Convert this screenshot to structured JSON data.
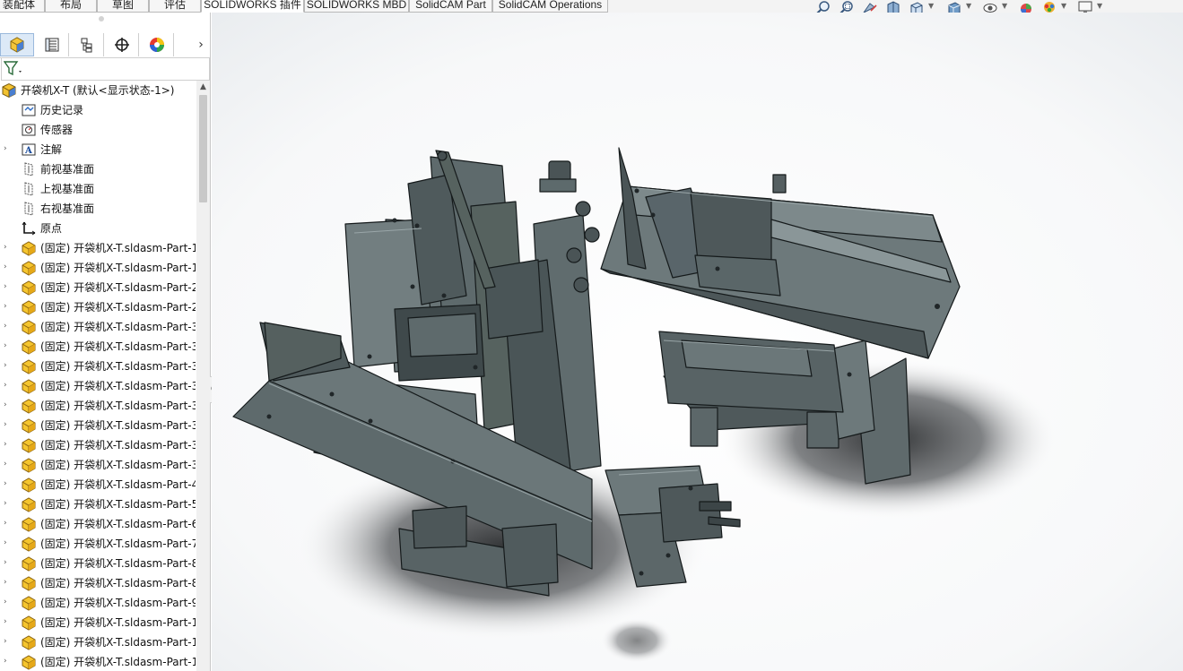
{
  "command_tabs": [
    {
      "label": "装配体"
    },
    {
      "label": "布局"
    },
    {
      "label": "草图"
    },
    {
      "label": "评估"
    },
    {
      "label": "SOLIDWORKS 插件"
    },
    {
      "label": "SOLIDWORKS MBD"
    },
    {
      "label": "SolidCAM Part"
    },
    {
      "label": "SolidCAM Operations"
    }
  ],
  "active_tab": "SOLIDWORKS 插件",
  "view_toolbar_icons": [
    "zoom-to-fit-icon",
    "zoom-to-area-icon",
    "previous-view-icon",
    "section-view-icon",
    "view-orientation-icon",
    "display-style-icon",
    "hide-show-items-icon",
    "edit-appearance-icon",
    "apply-scene-icon",
    "view-settings-icon"
  ],
  "panel_tabs": [
    {
      "name": "feature-manager-tab-icon",
      "active": true
    },
    {
      "name": "property-manager-tab-icon",
      "active": false
    },
    {
      "name": "configuration-manager-tab-icon",
      "active": false
    },
    {
      "name": "dimxpert-manager-tab-icon",
      "active": false
    },
    {
      "name": "display-manager-tab-icon",
      "active": false
    }
  ],
  "tree": {
    "root": {
      "label": "开袋机X-T  (默认<显示状态-1>)"
    },
    "items": [
      {
        "label": "历史记录",
        "icon": "history-icon",
        "expandable": false
      },
      {
        "label": "传感器",
        "icon": "sensor-icon",
        "expandable": false
      },
      {
        "label": "注解",
        "icon": "annotation-icon",
        "expandable": true
      },
      {
        "label": "前视基准面",
        "icon": "plane-icon",
        "expandable": false
      },
      {
        "label": "上视基准面",
        "icon": "plane-icon",
        "expandable": false
      },
      {
        "label": "右视基准面",
        "icon": "plane-icon",
        "expandable": false
      },
      {
        "label": "原点",
        "icon": "origin-icon",
        "expandable": false
      },
      {
        "label": "(固定) 开袋机X-T.sldasm-Part-1",
        "icon": "part-icon",
        "expandable": true
      },
      {
        "label": "(固定) 开袋机X-T.sldasm-Part-1",
        "icon": "part-icon",
        "expandable": true
      },
      {
        "label": "(固定) 开袋机X-T.sldasm-Part-2",
        "icon": "part-icon",
        "expandable": true
      },
      {
        "label": "(固定) 开袋机X-T.sldasm-Part-2",
        "icon": "part-icon",
        "expandable": true
      },
      {
        "label": "(固定) 开袋机X-T.sldasm-Part-3",
        "icon": "part-icon",
        "expandable": true
      },
      {
        "label": "(固定) 开袋机X-T.sldasm-Part-3",
        "icon": "part-icon",
        "expandable": true
      },
      {
        "label": "(固定) 开袋机X-T.sldasm-Part-3",
        "icon": "part-icon",
        "expandable": true
      },
      {
        "label": "(固定) 开袋机X-T.sldasm-Part-3",
        "icon": "part-icon",
        "expandable": true
      },
      {
        "label": "(固定) 开袋机X-T.sldasm-Part-3",
        "icon": "part-icon",
        "expandable": true
      },
      {
        "label": "(固定) 开袋机X-T.sldasm-Part-3",
        "icon": "part-icon",
        "expandable": true
      },
      {
        "label": "(固定) 开袋机X-T.sldasm-Part-3",
        "icon": "part-icon",
        "expandable": true
      },
      {
        "label": "(固定) 开袋机X-T.sldasm-Part-3",
        "icon": "part-icon",
        "expandable": true
      },
      {
        "label": "(固定) 开袋机X-T.sldasm-Part-4",
        "icon": "part-icon",
        "expandable": true
      },
      {
        "label": "(固定) 开袋机X-T.sldasm-Part-5",
        "icon": "part-icon",
        "expandable": true
      },
      {
        "label": "(固定) 开袋机X-T.sldasm-Part-6",
        "icon": "part-icon",
        "expandable": true
      },
      {
        "label": "(固定) 开袋机X-T.sldasm-Part-7",
        "icon": "part-icon",
        "expandable": true
      },
      {
        "label": "(固定) 开袋机X-T.sldasm-Part-8",
        "icon": "part-icon",
        "expandable": true
      },
      {
        "label": "(固定) 开袋机X-T.sldasm-Part-8",
        "icon": "part-icon",
        "expandable": true
      },
      {
        "label": "(固定) 开袋机X-T.sldasm-Part-9",
        "icon": "part-icon",
        "expandable": true
      },
      {
        "label": "(固定) 开袋机X-T.sldasm-Part-1",
        "icon": "part-icon",
        "expandable": true
      },
      {
        "label": "(固定) 开袋机X-T.sldasm-Part-1",
        "icon": "part-icon",
        "expandable": true
      },
      {
        "label": "(固定) 开袋机X-T.sldasm-Part-1",
        "icon": "part-icon",
        "expandable": true
      }
    ]
  },
  "colors": {
    "part_body": "#5f6a6c",
    "part_face_light": "#7d898b",
    "part_edge": "#151a1b",
    "part_icon": "#f2c230",
    "active_tab_bg": "#dce9f7"
  }
}
